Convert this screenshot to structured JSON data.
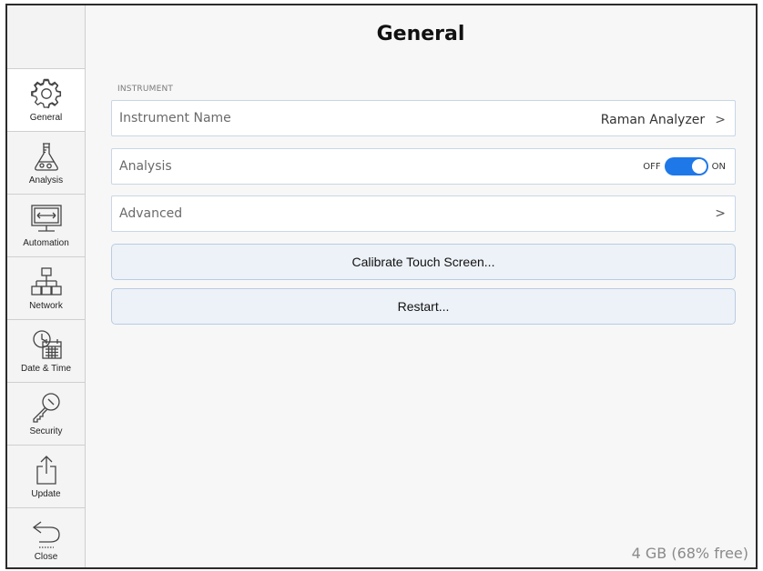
{
  "header": {
    "title": "General"
  },
  "sidebar": {
    "items": [
      {
        "label": "General",
        "icon": "gear-icon",
        "active": true
      },
      {
        "label": "Analysis",
        "icon": "flask-icon"
      },
      {
        "label": "Automation",
        "icon": "monitor-arrows-icon"
      },
      {
        "label": "Network",
        "icon": "network-icon"
      },
      {
        "label": "Date & Time",
        "icon": "clock-calendar-icon"
      },
      {
        "label": "Security",
        "icon": "key-icon"
      },
      {
        "label": "Update",
        "icon": "share-upload-icon"
      },
      {
        "label": "Close",
        "icon": "back-arrow-icon"
      }
    ]
  },
  "main": {
    "section_label": "INSTRUMENT",
    "instrument_name": {
      "label": "Instrument Name",
      "value": "Raman Analyzer",
      "chevron": ">"
    },
    "analysis": {
      "label": "Analysis",
      "off_label": "OFF",
      "on_label": "ON",
      "state": "on"
    },
    "advanced": {
      "label": "Advanced",
      "chevron": ">"
    },
    "calibrate_button": "Calibrate Touch Screen...",
    "restart_button": "Restart...",
    "storage": "4 GB (68% free)"
  },
  "colors": {
    "toggle_on": "#1e78e8",
    "button_bg": "#edf2f8",
    "row_border": "#c9d6e6"
  }
}
